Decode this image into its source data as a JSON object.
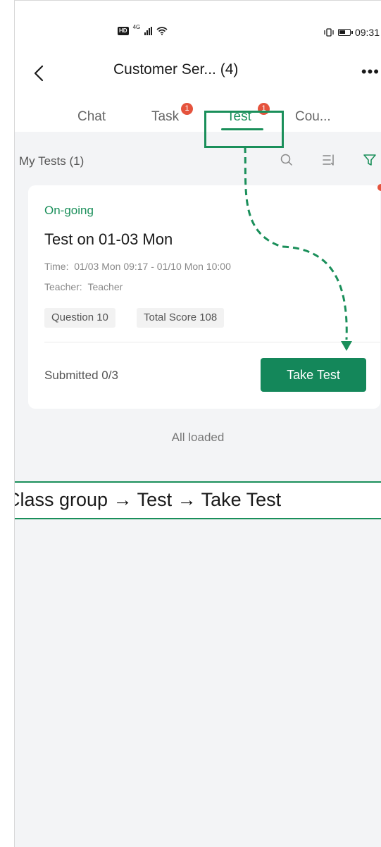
{
  "status_bar": {
    "hd": "HD",
    "network": "4G",
    "time": "09:31"
  },
  "header": {
    "title": "Customer Ser...  (4)",
    "back_icon": "chevron-left-icon",
    "more_icon": "more-dots-icon"
  },
  "tabs": [
    {
      "label": "Chat",
      "badge": ""
    },
    {
      "label": "Task",
      "badge": "1"
    },
    {
      "label": "Test",
      "badge": "1",
      "active": true
    },
    {
      "label": "Cou...",
      "badge": ""
    }
  ],
  "list": {
    "label": "My Tests (1)",
    "icons": [
      "search-icon",
      "sort-icon",
      "filter-icon"
    ]
  },
  "card": {
    "status": "On-going",
    "title": "Test on 01-03 Mon",
    "time_label": "Time:",
    "time_value": "01/03 Mon 09:17 - 01/10 Mon 10:00",
    "teacher_label": "Teacher:",
    "teacher_value": "Teacher",
    "chips": [
      "Question 10",
      "Total Score 108"
    ],
    "submitted": "Submitted 0/3",
    "button": "Take Test"
  },
  "footer_text": "All loaded",
  "caption": "Class group → Test → Take Test",
  "colors": {
    "accent": "#1a8f5a",
    "button": "#14875a",
    "badge": "#e5533d",
    "background": "#f3f4f6"
  }
}
